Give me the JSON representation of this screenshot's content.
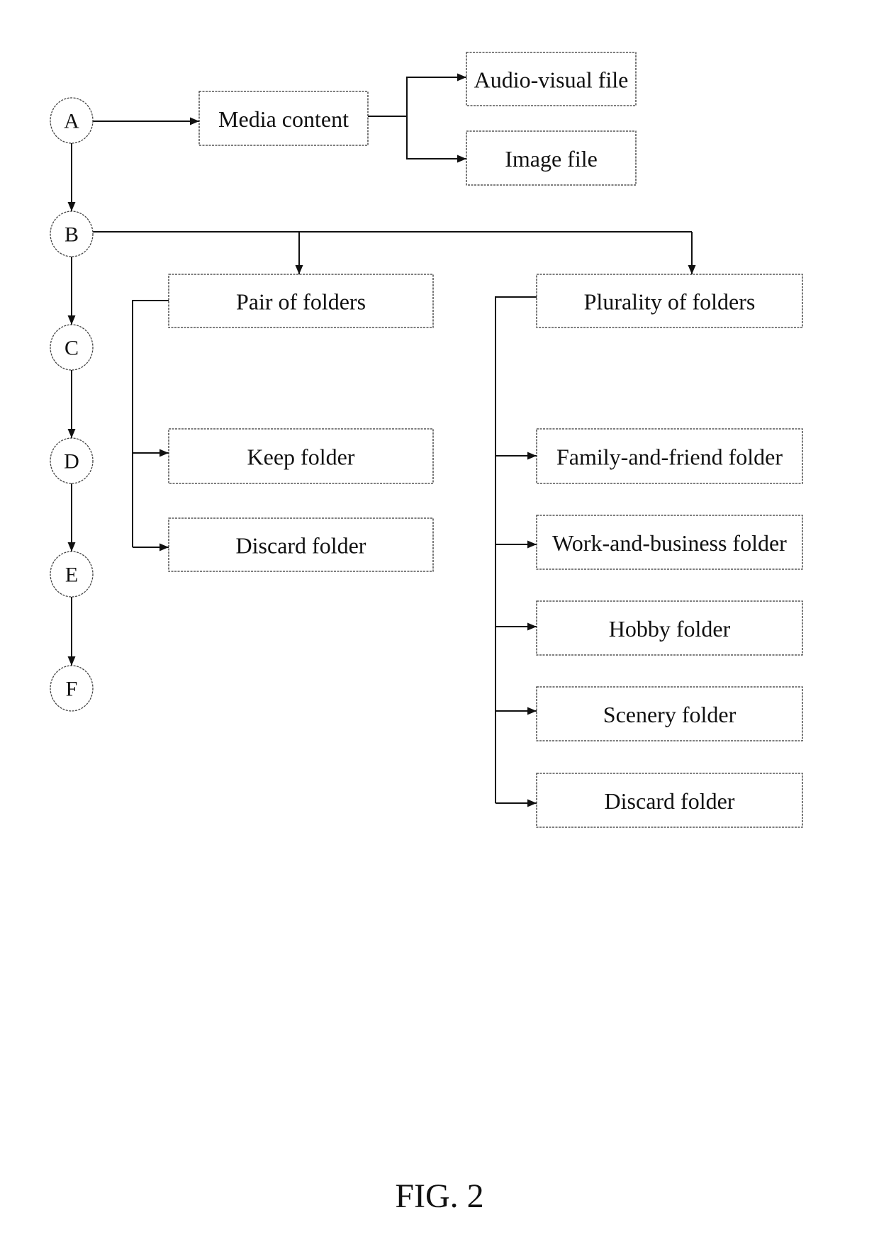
{
  "figure": {
    "caption": "FIG. 2"
  },
  "steps": [
    {
      "id": "A",
      "label": "A"
    },
    {
      "id": "B",
      "label": "B"
    },
    {
      "id": "C",
      "label": "C"
    },
    {
      "id": "D",
      "label": "D"
    },
    {
      "id": "E",
      "label": "E"
    },
    {
      "id": "F",
      "label": "F"
    }
  ],
  "boxes": {
    "media_content": "Media content",
    "audio_visual_file": "Audio-visual file",
    "image_file": "Image file",
    "pair_of_folders": "Pair of folders",
    "keep_folder": "Keep folder",
    "discard_folder_pair": "Discard folder",
    "plurality_of_folders": "Plurality of folders",
    "family_and_friend_folder": "Family-and-friend folder",
    "work_and_business_folder": "Work-and-business folder",
    "hobby_folder": "Hobby folder",
    "scenery_folder": "Scenery folder",
    "discard_folder_plurality": "Discard folder"
  },
  "connections": [
    {
      "from": "A",
      "to": "B"
    },
    {
      "from": "B",
      "to": "C"
    },
    {
      "from": "C",
      "to": "D"
    },
    {
      "from": "D",
      "to": "E"
    },
    {
      "from": "E",
      "to": "F"
    },
    {
      "from": "A",
      "to": "media_content"
    },
    {
      "from": "media_content",
      "to": "audio_visual_file"
    },
    {
      "from": "media_content",
      "to": "image_file"
    },
    {
      "from": "B",
      "to": "pair_of_folders"
    },
    {
      "from": "B",
      "to": "plurality_of_folders"
    },
    {
      "from": "pair_of_folders",
      "to": "keep_folder"
    },
    {
      "from": "pair_of_folders",
      "to": "discard_folder_pair"
    },
    {
      "from": "plurality_of_folders",
      "to": "family_and_friend_folder"
    },
    {
      "from": "plurality_of_folders",
      "to": "work_and_business_folder"
    },
    {
      "from": "plurality_of_folders",
      "to": "hobby_folder"
    },
    {
      "from": "plurality_of_folders",
      "to": "scenery_folder"
    },
    {
      "from": "plurality_of_folders",
      "to": "discard_folder_plurality"
    }
  ]
}
